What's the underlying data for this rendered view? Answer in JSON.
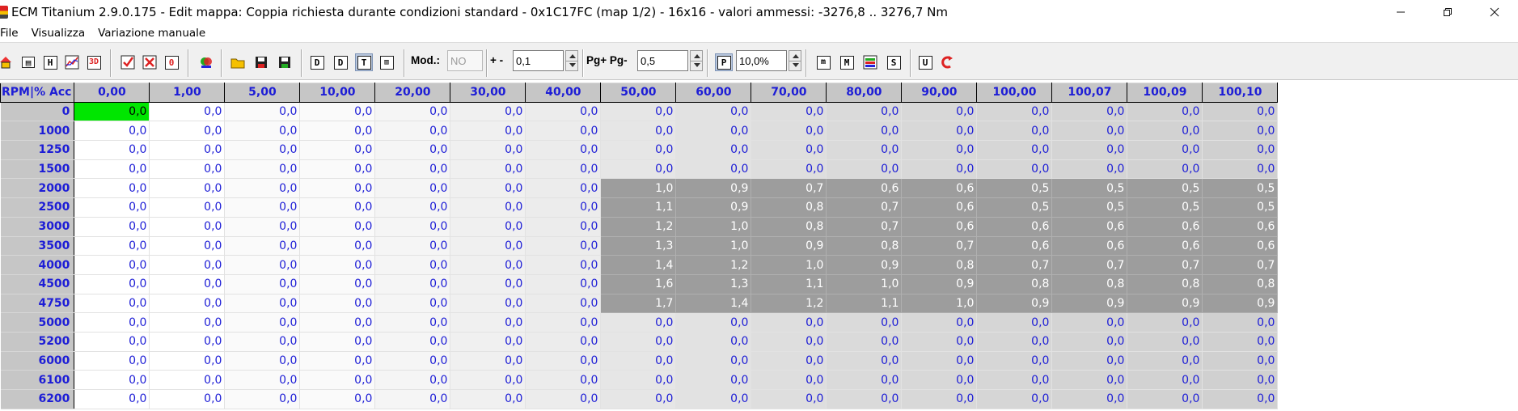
{
  "title": "ECM Titanium 2.9.0.175 - Edit mappa: Coppia richiesta durante condizioni standard - 0x1C17FC (map 1/2) - 16x16 - valori ammessi: -3276,8 .. 3276,7 Nm",
  "window_controls": {
    "minimize_icon": "minimize-icon",
    "restore_icon": "restore-icon",
    "close_icon": "close-icon"
  },
  "menu": {
    "file": "File",
    "view": "Visualizza",
    "manual": "Variazione manuale"
  },
  "toolbar": {
    "mod_label": "Mod.:",
    "mod_value": "NO",
    "plusminus_label": "+ -",
    "step_value": "0,1",
    "pg_label": "Pg+ Pg-",
    "pg_value": "0,5",
    "percent_value": "10,0%",
    "icons": {
      "home": "Home",
      "table": "H",
      "chart": "chart",
      "view3d": "3D",
      "check": "V",
      "cross": "X",
      "zero": "0",
      "map": "map",
      "open": "open",
      "save": "save",
      "save_as": "save as",
      "d1": "D",
      "d2": "D",
      "d3": "T",
      "d4": "split",
      "p": "P",
      "m1": "m",
      "m2": "M",
      "m3": "img",
      "s": "S",
      "u": "U",
      "undo": "C"
    }
  },
  "grid": {
    "corner": "RPM|% Acc",
    "columns": [
      "0,00",
      "1,00",
      "5,00",
      "10,00",
      "20,00",
      "30,00",
      "40,00",
      "50,00",
      "60,00",
      "70,00",
      "80,00",
      "90,00",
      "100,00",
      "100,07",
      "100,09",
      "100,10"
    ],
    "rows": [
      {
        "rpm": "0",
        "values": [
          "0,0",
          "0,0",
          "0,0",
          "0,0",
          "0,0",
          "0,0",
          "0,0",
          "0,0",
          "0,0",
          "0,0",
          "0,0",
          "0,0",
          "0,0",
          "0,0",
          "0,0",
          "0,0"
        ]
      },
      {
        "rpm": "1000",
        "values": [
          "0,0",
          "0,0",
          "0,0",
          "0,0",
          "0,0",
          "0,0",
          "0,0",
          "0,0",
          "0,0",
          "0,0",
          "0,0",
          "0,0",
          "0,0",
          "0,0",
          "0,0",
          "0,0"
        ]
      },
      {
        "rpm": "1250",
        "values": [
          "0,0",
          "0,0",
          "0,0",
          "0,0",
          "0,0",
          "0,0",
          "0,0",
          "0,0",
          "0,0",
          "0,0",
          "0,0",
          "0,0",
          "0,0",
          "0,0",
          "0,0",
          "0,0"
        ]
      },
      {
        "rpm": "1500",
        "values": [
          "0,0",
          "0,0",
          "0,0",
          "0,0",
          "0,0",
          "0,0",
          "0,0",
          "0,0",
          "0,0",
          "0,0",
          "0,0",
          "0,0",
          "0,0",
          "0,0",
          "0,0",
          "0,0"
        ]
      },
      {
        "rpm": "2000",
        "values": [
          "0,0",
          "0,0",
          "0,0",
          "0,0",
          "0,0",
          "0,0",
          "0,0",
          "1,0",
          "0,9",
          "0,7",
          "0,6",
          "0,6",
          "0,5",
          "0,5",
          "0,5",
          "0,5"
        ]
      },
      {
        "rpm": "2500",
        "values": [
          "0,0",
          "0,0",
          "0,0",
          "0,0",
          "0,0",
          "0,0",
          "0,0",
          "1,1",
          "0,9",
          "0,8",
          "0,7",
          "0,6",
          "0,5",
          "0,5",
          "0,5",
          "0,5"
        ]
      },
      {
        "rpm": "3000",
        "values": [
          "0,0",
          "0,0",
          "0,0",
          "0,0",
          "0,0",
          "0,0",
          "0,0",
          "1,2",
          "1,0",
          "0,8",
          "0,7",
          "0,6",
          "0,6",
          "0,6",
          "0,6",
          "0,6"
        ]
      },
      {
        "rpm": "3500",
        "values": [
          "0,0",
          "0,0",
          "0,0",
          "0,0",
          "0,0",
          "0,0",
          "0,0",
          "1,3",
          "1,0",
          "0,9",
          "0,8",
          "0,7",
          "0,6",
          "0,6",
          "0,6",
          "0,6"
        ]
      },
      {
        "rpm": "4000",
        "values": [
          "0,0",
          "0,0",
          "0,0",
          "0,0",
          "0,0",
          "0,0",
          "0,0",
          "1,4",
          "1,2",
          "1,0",
          "0,9",
          "0,8",
          "0,7",
          "0,7",
          "0,7",
          "0,7"
        ]
      },
      {
        "rpm": "4500",
        "values": [
          "0,0",
          "0,0",
          "0,0",
          "0,0",
          "0,0",
          "0,0",
          "0,0",
          "1,6",
          "1,3",
          "1,1",
          "1,0",
          "0,9",
          "0,8",
          "0,8",
          "0,8",
          "0,8"
        ]
      },
      {
        "rpm": "4750",
        "values": [
          "0,0",
          "0,0",
          "0,0",
          "0,0",
          "0,0",
          "0,0",
          "0,0",
          "1,7",
          "1,4",
          "1,2",
          "1,1",
          "1,0",
          "0,9",
          "0,9",
          "0,9",
          "0,9"
        ]
      },
      {
        "rpm": "5000",
        "values": [
          "0,0",
          "0,0",
          "0,0",
          "0,0",
          "0,0",
          "0,0",
          "0,0",
          "0,0",
          "0,0",
          "0,0",
          "0,0",
          "0,0",
          "0,0",
          "0,0",
          "0,0",
          "0,0"
        ]
      },
      {
        "rpm": "5200",
        "values": [
          "0,0",
          "0,0",
          "0,0",
          "0,0",
          "0,0",
          "0,0",
          "0,0",
          "0,0",
          "0,0",
          "0,0",
          "0,0",
          "0,0",
          "0,0",
          "0,0",
          "0,0",
          "0,0"
        ]
      },
      {
        "rpm": "6000",
        "values": [
          "0,0",
          "0,0",
          "0,0",
          "0,0",
          "0,0",
          "0,0",
          "0,0",
          "0,0",
          "0,0",
          "0,0",
          "0,0",
          "0,0",
          "0,0",
          "0,0",
          "0,0",
          "0,0"
        ]
      },
      {
        "rpm": "6100",
        "values": [
          "0,0",
          "0,0",
          "0,0",
          "0,0",
          "0,0",
          "0,0",
          "0,0",
          "0,0",
          "0,0",
          "0,0",
          "0,0",
          "0,0",
          "0,0",
          "0,0",
          "0,0",
          "0,0"
        ]
      },
      {
        "rpm": "6200",
        "values": [
          "0,0",
          "0,0",
          "0,0",
          "0,0",
          "0,0",
          "0,0",
          "0,0",
          "0,0",
          "0,0",
          "0,0",
          "0,0",
          "0,0",
          "0,0",
          "0,0",
          "0,0",
          "0,0"
        ]
      }
    ],
    "selected_cell": {
      "row": 0,
      "col": 0
    },
    "highlight_rows": [
      4,
      10
    ],
    "highlight_cols": [
      7,
      15
    ],
    "colors": {
      "selected": "#00e600",
      "highlight": "#9d9d9d",
      "value": "#1d1dd6",
      "header_bg": "#c6c6c6"
    }
  }
}
